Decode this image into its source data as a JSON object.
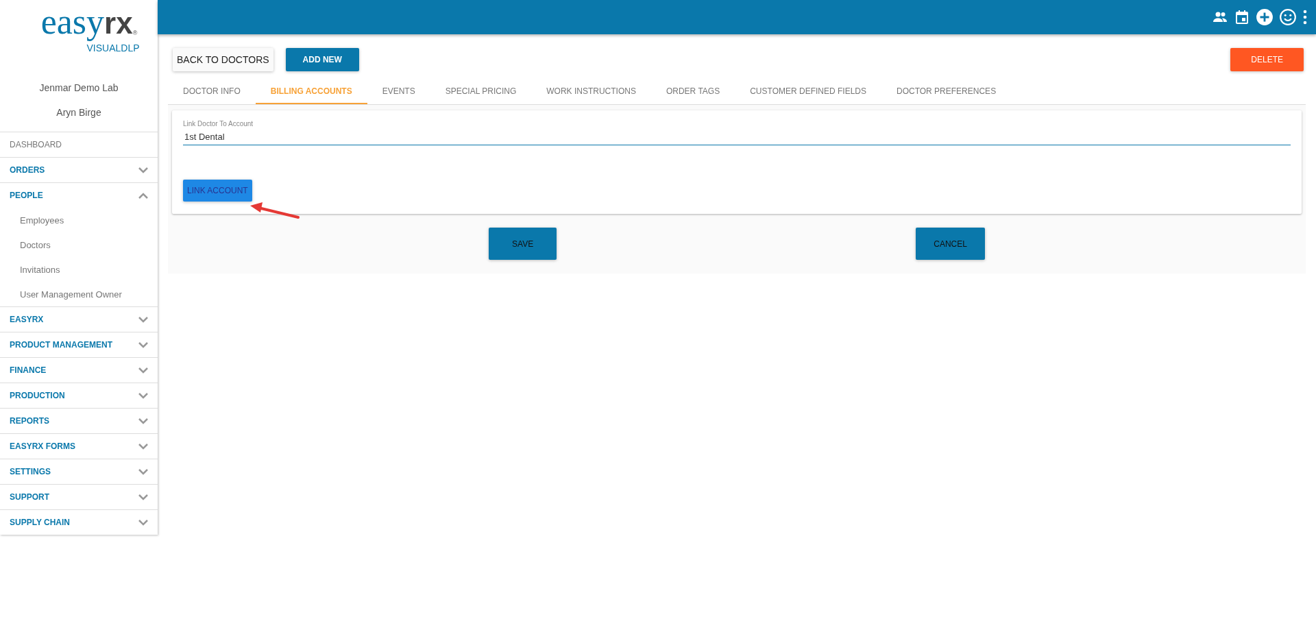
{
  "logo": {
    "part_1": "easy",
    "part_2": "rx",
    "mark": "®",
    "subtitle": "VISUALDLP"
  },
  "sidebar": {
    "organization": "Jenmar Demo Lab",
    "user": "Aryn Birge",
    "items": [
      {
        "label": "DASHBOARD",
        "kind": "link"
      },
      {
        "label": "ORDERS",
        "kind": "group",
        "expanded": false
      },
      {
        "label": "PEOPLE",
        "kind": "group",
        "expanded": true,
        "children": [
          {
            "label": "Employees"
          },
          {
            "label": "Doctors"
          },
          {
            "label": "Invitations"
          },
          {
            "label": "User Management Owner"
          }
        ]
      },
      {
        "label": "EASYRX",
        "kind": "group",
        "expanded": false
      },
      {
        "label": "PRODUCT MANAGEMENT",
        "kind": "group",
        "expanded": false
      },
      {
        "label": "FINANCE",
        "kind": "group",
        "expanded": false
      },
      {
        "label": "PRODUCTION",
        "kind": "group",
        "expanded": false
      },
      {
        "label": "REPORTS",
        "kind": "group",
        "expanded": false
      },
      {
        "label": "EASYRX FORMS",
        "kind": "group",
        "expanded": false
      },
      {
        "label": "SETTINGS",
        "kind": "group",
        "expanded": false
      },
      {
        "label": "SUPPORT",
        "kind": "group",
        "expanded": false
      },
      {
        "label": "SUPPLY CHAIN",
        "kind": "group",
        "expanded": false
      }
    ]
  },
  "toolbar": {
    "back_button": "BACK TO DOCTORS",
    "add_button": "ADD NEW",
    "delete_button": "DELETE"
  },
  "tabs": [
    {
      "label": "DOCTOR INFO",
      "selected": false
    },
    {
      "label": "BILLING ACCOUNTS",
      "selected": true
    },
    {
      "label": "EVENTS",
      "selected": false
    },
    {
      "label": "SPECIAL PRICING",
      "selected": false
    },
    {
      "label": "WORK INSTRUCTIONS",
      "selected": false
    },
    {
      "label": "ORDER TAGS",
      "selected": false
    },
    {
      "label": "CUSTOMER DEFINED FIELDS",
      "selected": false
    },
    {
      "label": "DOCTOR PREFERENCES",
      "selected": false
    }
  ],
  "form": {
    "field_label": "Link Doctor To Account",
    "field_value": "1st Dental",
    "link_button": "LINK ACCOUNT"
  },
  "actions": {
    "save": "SAVE",
    "cancel": "CANCEL"
  }
}
